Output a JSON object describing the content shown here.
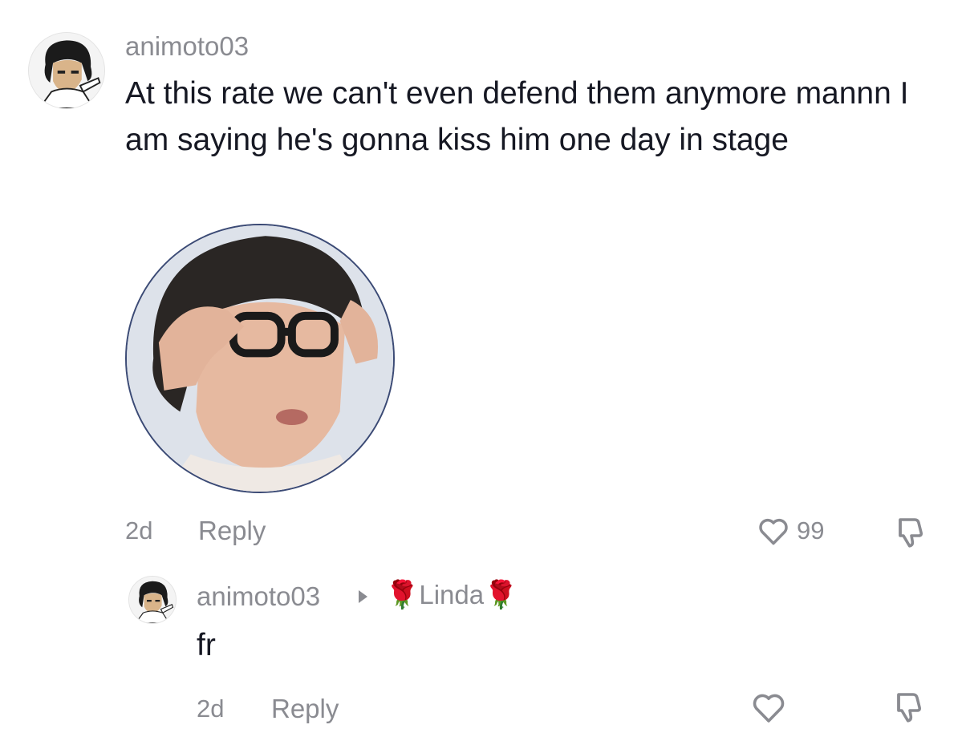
{
  "comment": {
    "username": "animoto03",
    "text": "At this rate we can't even defend them anymore mannn I am saying he's gonna kiss him one day in stage",
    "time": "2d",
    "reply_label": "Reply",
    "like_count": "99",
    "sticker_icon": "photo-sticker"
  },
  "reply": {
    "username": "animoto03",
    "reply_to": "Linda",
    "reply_to_prefix_emoji": "🌹",
    "reply_to_suffix_emoji": "🌹",
    "text": "fr",
    "time": "2d",
    "reply_label": "Reply",
    "like_count": ""
  },
  "icons": {
    "like": "heart-outline-icon",
    "dislike": "thumbs-down-outline-icon",
    "reply_arrow": "caret-right-icon"
  },
  "colors": {
    "text": "#161823",
    "muted": "#8a8b91",
    "background": "#ffffff"
  }
}
